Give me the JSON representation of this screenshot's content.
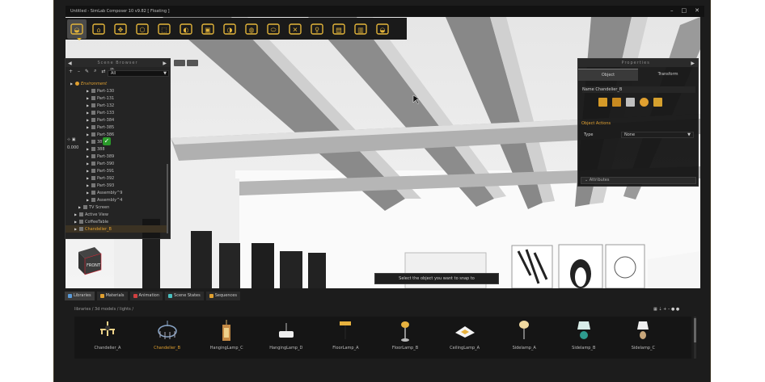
{
  "window": {
    "title": "Untitled - SimLab Composer 10 v9.82 [ Floating ]",
    "minimize_glyph": "–",
    "maximize_glyph": "□",
    "close_glyph": "✕"
  },
  "toolbar": {
    "items": [
      {
        "icon": "vr-headset-icon",
        "active": true
      },
      {
        "icon": "bag-icon"
      },
      {
        "icon": "move-icon"
      },
      {
        "icon": "cube-icon"
      },
      {
        "icon": "select-box-icon"
      },
      {
        "icon": "materials-icon"
      },
      {
        "icon": "texture-icon"
      },
      {
        "icon": "paint-icon"
      },
      {
        "icon": "globe-icon"
      },
      {
        "icon": "panorama-360-icon"
      },
      {
        "icon": "tools-icon"
      },
      {
        "icon": "light-icon"
      },
      {
        "icon": "presentation-icon"
      },
      {
        "icon": "film-icon"
      },
      {
        "icon": "vr-view-icon"
      }
    ]
  },
  "scene_browser": {
    "title": "Scene Browser",
    "filter_value": "All",
    "tools": [
      "+",
      "–",
      "✎",
      "⌕",
      "⇄",
      "⎘"
    ],
    "tiny_value": "0.000",
    "rows": [
      {
        "label": "Environment",
        "indent": 0,
        "kind": "env"
      },
      {
        "label": "Part-130",
        "indent": 4
      },
      {
        "label": "Part-131",
        "indent": 4
      },
      {
        "label": "Part-132",
        "indent": 4
      },
      {
        "label": "Part-133",
        "indent": 4
      },
      {
        "label": "Part-384",
        "indent": 4
      },
      {
        "label": "Part-385",
        "indent": 4
      },
      {
        "label": "Part-386",
        "indent": 4
      },
      {
        "label": "387",
        "indent": 4
      },
      {
        "label": "388",
        "indent": 4
      },
      {
        "label": "Part-389",
        "indent": 4
      },
      {
        "label": "Part-390",
        "indent": 4
      },
      {
        "label": "Part-391",
        "indent": 4
      },
      {
        "label": "Part-392",
        "indent": 4
      },
      {
        "label": "Part-393",
        "indent": 4
      },
      {
        "label": "Assembly^9",
        "indent": 4
      },
      {
        "label": "Assembly^4",
        "indent": 4
      },
      {
        "label": "TV Screen",
        "indent": 2
      },
      {
        "label": "Active View",
        "indent": 1
      },
      {
        "label": "CoffeeTable",
        "indent": 1
      },
      {
        "label": "Chandelier_B",
        "indent": 1,
        "selected": true
      }
    ]
  },
  "properties": {
    "title": "Properties",
    "tabs": [
      "Object",
      "Transform"
    ],
    "name_label": "Name",
    "name_value": "Chandelier_B",
    "section_title": "Object Actions",
    "type_label": "Type",
    "type_value": "None",
    "attributes_label": "Attributes"
  },
  "viewport": {
    "tooltip": "Select the object you want to snap to",
    "cube_label": "FRONT"
  },
  "library": {
    "tabs": [
      {
        "label": "Libraries",
        "active": true,
        "color": "#5a9ad8"
      },
      {
        "label": "Materials",
        "color": "#e0a030"
      },
      {
        "label": "Animation",
        "color": "#d04040"
      },
      {
        "label": "Scene States",
        "color": "#4ac0c0"
      },
      {
        "label": "Sequences",
        "color": "#e0a030"
      }
    ],
    "path": "libraries  /  3d models  /  lights  /",
    "tools": "▦ ⇣ + – ● ●",
    "items": [
      {
        "label": "Chandelier_A",
        "icon": "chandelier-a-icon"
      },
      {
        "label": "Chandelier_B",
        "icon": "chandelier-b-icon",
        "selected": true
      },
      {
        "label": "HangingLamp_C",
        "icon": "hanging-lamp-c-icon"
      },
      {
        "label": "HangingLamp_D",
        "icon": "hanging-lamp-d-icon"
      },
      {
        "label": "FloorLamp_A",
        "icon": "floor-lamp-a-icon"
      },
      {
        "label": "FloorLamp_B",
        "icon": "floor-lamp-b-icon"
      },
      {
        "label": "CeilingLamp_A",
        "icon": "ceiling-lamp-a-icon"
      },
      {
        "label": "Sidelamp_A",
        "icon": "sidelamp-a-icon"
      },
      {
        "label": "Sidelamp_B",
        "icon": "sidelamp-b-icon"
      },
      {
        "label": "Sidelamp_C",
        "icon": "sidelamp-c-icon"
      }
    ]
  },
  "colors": {
    "accent": "#e0a030",
    "panel": "#141414",
    "frame": "#1c1c1c"
  }
}
